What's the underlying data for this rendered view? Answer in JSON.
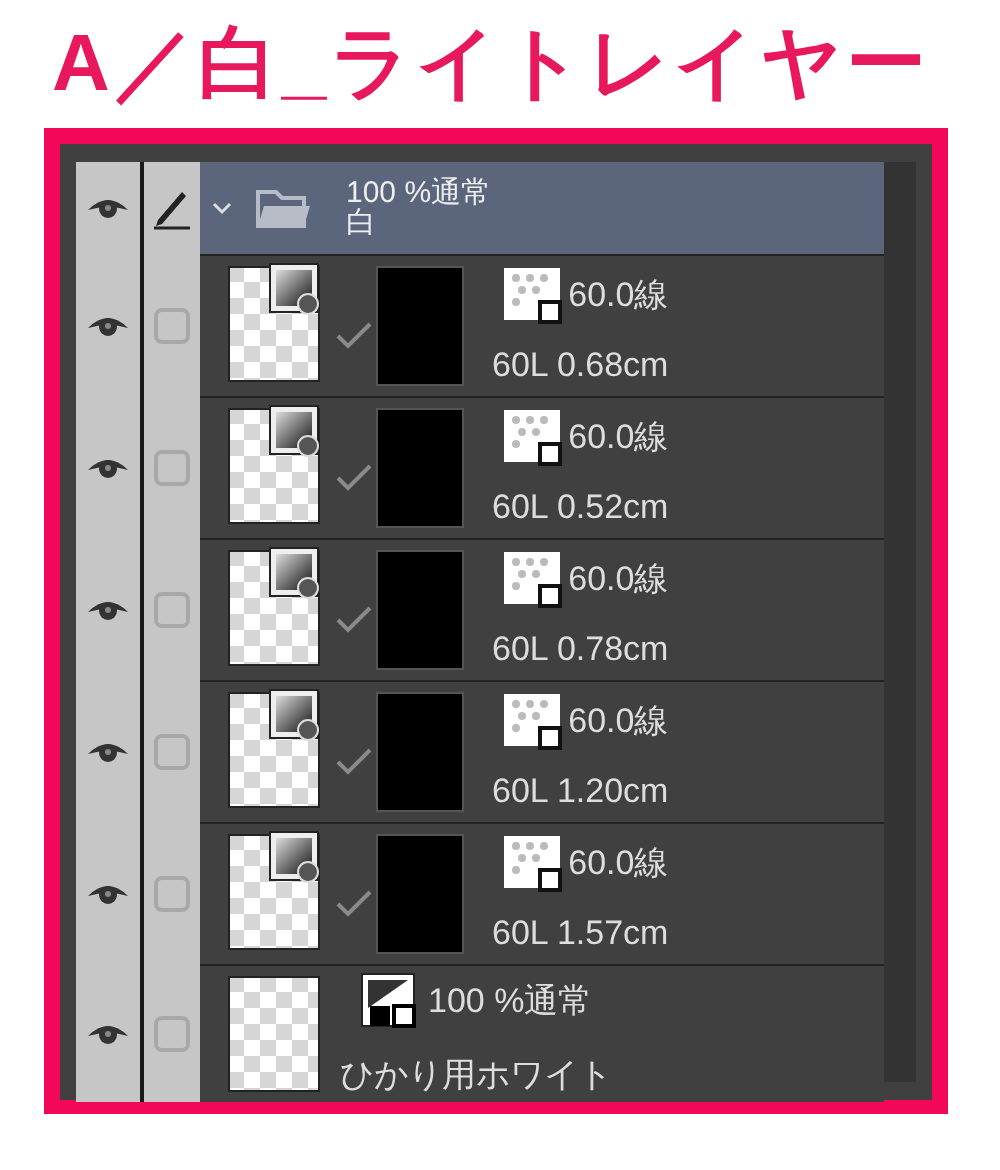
{
  "title": "A／白_ライトレイヤー",
  "folder": {
    "visible": true,
    "edit_target": true,
    "expanded": true,
    "selected": true,
    "blend": "100 %通常",
    "name": "白"
  },
  "layers": [
    {
      "kind": "tone",
      "visible": true,
      "edit_target": false,
      "selected": false,
      "mask_enabled": true,
      "blend": "60.0線",
      "name": "60L 0.68cm"
    },
    {
      "kind": "tone",
      "visible": true,
      "edit_target": false,
      "selected": false,
      "mask_enabled": true,
      "blend": "60.0線",
      "name": "60L 0.52cm"
    },
    {
      "kind": "tone",
      "visible": true,
      "edit_target": false,
      "selected": false,
      "mask_enabled": true,
      "blend": "60.0線",
      "name": "60L 0.78cm"
    },
    {
      "kind": "tone",
      "visible": true,
      "edit_target": false,
      "selected": false,
      "mask_enabled": true,
      "blend": "60.0線",
      "name": "60L 1.20cm"
    },
    {
      "kind": "tone",
      "visible": true,
      "edit_target": false,
      "selected": false,
      "mask_enabled": true,
      "blend": "60.0線",
      "name": "60L 1.57cm"
    },
    {
      "kind": "raster",
      "visible": true,
      "edit_target": false,
      "selected": false,
      "blend": "100 %通常",
      "name": "ひかり用ホワイト"
    }
  ]
}
